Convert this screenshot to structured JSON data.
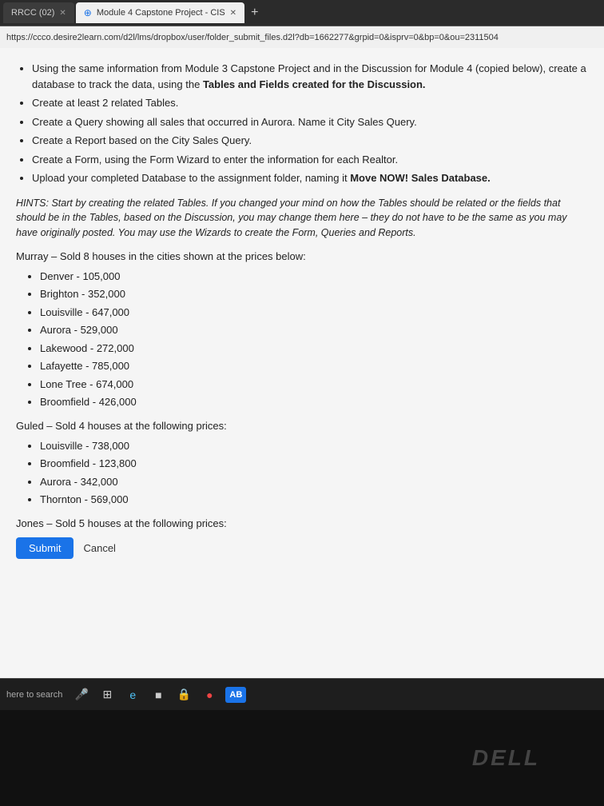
{
  "browser": {
    "tabs": [
      {
        "id": "tab1",
        "label": "RRCC (02)",
        "active": false,
        "has_icon": false
      },
      {
        "id": "tab2",
        "label": "Module 4 Capstone Project - CIS",
        "active": true,
        "has_icon": true
      }
    ],
    "add_tab_label": "+",
    "address_bar": "https://ccco.desire2learn.com/d2l/lms/dropbox/user/folder_submit_files.d2l?db=1662277&grpid=0&isprv=0&bp=0&ou=2311504"
  },
  "page": {
    "instructions": {
      "bullet1_prefix": "Using the same information from Module 3 Capstone Project and in the Discussion for Module 4 (copied below), create a database to track the data, using the ",
      "bullet1_bold": "Tables and Fields created for the Discussion.",
      "bullet2": "Create at least 2 related Tables.",
      "bullet3": "Create a Query showing all sales that occurred in Aurora. Name it City Sales Query.",
      "bullet4": "Create a Report based on the City Sales Query.",
      "bullet5": "Create a Form, using the Form Wizard to enter the information for each Realtor.",
      "bullet6_prefix": "Upload your completed Database to the assignment folder, naming it ",
      "bullet6_bold": "Move NOW! Sales Database."
    },
    "hints": "HINTS: Start by creating the related Tables. If you changed your mind on how the Tables should be related or the fields that should be in the Tables, based on the Discussion, you may change them here – they do not have to be the same as you may have originally posted. You may use the Wizards to create the Form, Queries and Reports.",
    "murray_title": "Murray – Sold 8 houses in the cities shown at the prices below:",
    "murray_sales": [
      {
        "city": "Denver",
        "price": "105,000"
      },
      {
        "city": "Brighton",
        "price": "352,000"
      },
      {
        "city": "Louisville",
        "price": "647,000"
      },
      {
        "city": "Aurora",
        "price": "529,000"
      },
      {
        "city": "Lakewood",
        "price": "272,000"
      },
      {
        "city": "Lafayette",
        "price": "785,000"
      },
      {
        "city": "Lone Tree",
        "price": "674,000"
      },
      {
        "city": "Broomfield",
        "price": "426,000"
      }
    ],
    "guled_title": "Guled – Sold 4 houses at the following prices:",
    "guled_sales": [
      {
        "city": "Louisville",
        "price": "738,000"
      },
      {
        "city": "Broomfield",
        "price": "123,800"
      },
      {
        "city": "Aurora",
        "price": "342,000"
      },
      {
        "city": "Thornton",
        "price": "569,000"
      }
    ],
    "jones_title": "Jones – Sold 5 houses at the following prices:",
    "submit_label": "Submit",
    "cancel_label": "Cancel"
  },
  "taskbar": {
    "search_placeholder": "here to search",
    "icons": [
      "🎤",
      "⊞",
      "e",
      "■",
      "🔒",
      "●",
      "AB"
    ]
  }
}
